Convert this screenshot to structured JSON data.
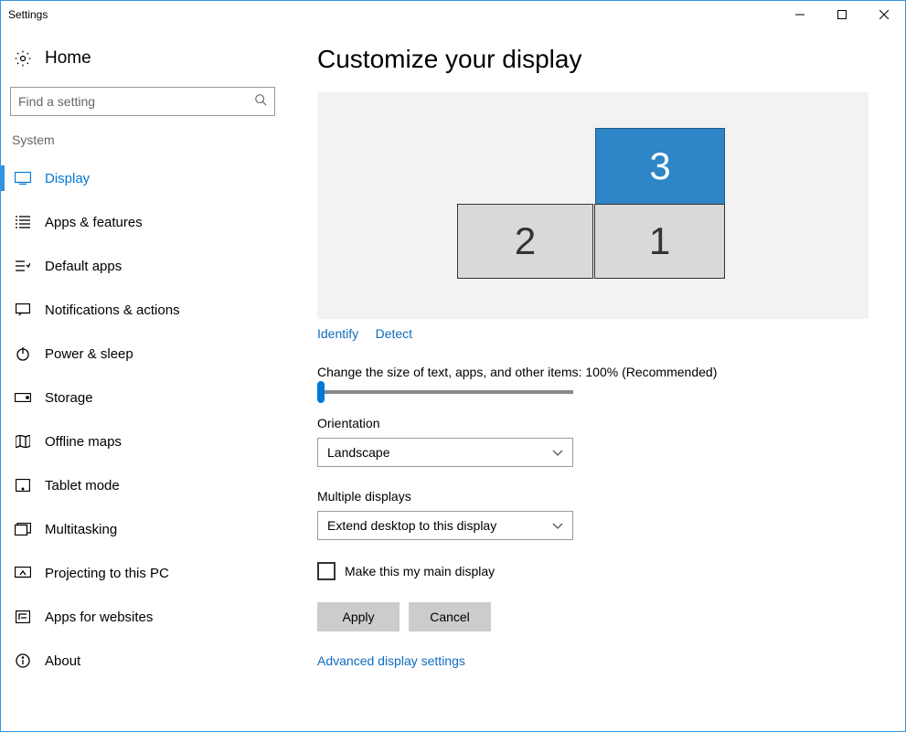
{
  "window": {
    "title": "Settings"
  },
  "sidebar": {
    "home": "Home",
    "search_placeholder": "Find a setting",
    "section": "System",
    "items": [
      {
        "label": "Display",
        "icon": "display-icon",
        "active": true
      },
      {
        "label": "Apps & features",
        "icon": "list-icon",
        "active": false
      },
      {
        "label": "Default apps",
        "icon": "defaults-icon",
        "active": false
      },
      {
        "label": "Notifications & actions",
        "icon": "notifications-icon",
        "active": false
      },
      {
        "label": "Power & sleep",
        "icon": "power-icon",
        "active": false
      },
      {
        "label": "Storage",
        "icon": "storage-icon",
        "active": false
      },
      {
        "label": "Offline maps",
        "icon": "map-icon",
        "active": false
      },
      {
        "label": "Tablet mode",
        "icon": "tablet-icon",
        "active": false
      },
      {
        "label": "Multitasking",
        "icon": "multitask-icon",
        "active": false
      },
      {
        "label": "Projecting to this PC",
        "icon": "project-icon",
        "active": false
      },
      {
        "label": "Apps for websites",
        "icon": "apps-web-icon",
        "active": false
      },
      {
        "label": "About",
        "icon": "about-icon",
        "active": false
      }
    ]
  },
  "main": {
    "title": "Customize your display",
    "monitors": {
      "m1": "1",
      "m2": "2",
      "m3": "3"
    },
    "identify": "Identify",
    "detect": "Detect",
    "scale_label": "Change the size of text, apps, and other items: 100% (Recommended)",
    "orientation_label": "Orientation",
    "orientation_value": "Landscape",
    "multi_label": "Multiple displays",
    "multi_value": "Extend desktop to this display",
    "main_display_checkbox": "Make this my main display",
    "apply": "Apply",
    "cancel": "Cancel",
    "advanced": "Advanced display settings"
  }
}
